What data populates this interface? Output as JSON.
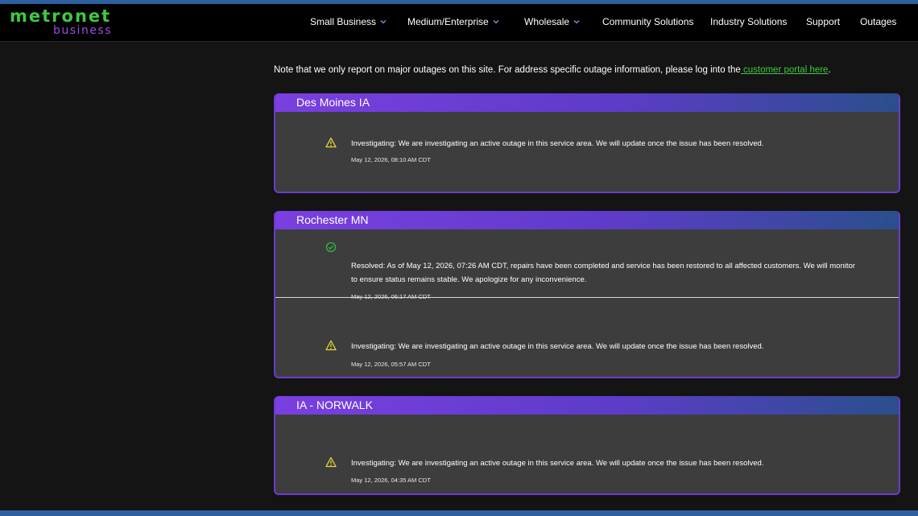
{
  "brand": {
    "name": "metronet",
    "sub": "business"
  },
  "nav": [
    {
      "label": "Small Business",
      "dropdown": true
    },
    {
      "label": "Medium/Enterprise",
      "dropdown": true
    },
    {
      "label": "Wholesale",
      "dropdown": true
    },
    {
      "label": "Community Solutions",
      "dropdown": false
    },
    {
      "label": "Industry Solutions",
      "dropdown": false
    },
    {
      "label": "Support",
      "dropdown": false
    },
    {
      "label": "Outages",
      "dropdown": false
    }
  ],
  "note": {
    "text": "Note that we only report on major outages on this site. For address specific outage information, please log into the",
    "link": " customer portal here",
    "end": "."
  },
  "outages": [
    {
      "location": "Des Moines IA",
      "entries": [
        {
          "status": "investigating",
          "icon": "warning-icon",
          "text": "Investigating: We are investigating an active outage in this service area. We will update once the issue has been resolved.",
          "time": "May 12, 2026, 08:10 AM CDT"
        }
      ]
    },
    {
      "location": "Rochester MN",
      "entries": [
        {
          "status": "resolved",
          "icon": "check-circle-icon",
          "text": "Resolved: As of May 12, 2026, 07:26 AM CDT, repairs have been completed and service has been restored to all affected customers. We will monitor to ensure status remains stable. We apologize for any inconvenience.",
          "time": "May 12, 2026, 06:17 AM CDT"
        },
        {
          "status": "investigating",
          "icon": "warning-icon",
          "text": "Investigating: We are investigating an active outage in this service area. We will update once the issue has been resolved.",
          "time": "May 12, 2026, 05:57 AM CDT"
        }
      ]
    },
    {
      "location": "IA - NORWALK",
      "entries": [
        {
          "status": "investigating",
          "icon": "warning-icon",
          "text": "Investigating: We are investigating an active outage in this service area. We will update once the issue has been resolved.",
          "time": "May 12, 2026, 04:35 AM CDT"
        }
      ]
    }
  ],
  "colors": {
    "brand_green": "#3fc93f",
    "brand_purple": "#9b4de0",
    "header_gradient_start": "#7a3fe0",
    "header_gradient_end": "#2a4f8c",
    "warning": "#e8d83a",
    "resolved": "#2fb84a",
    "card_bg": "#3d3d3d",
    "page_bg": "#141414"
  }
}
